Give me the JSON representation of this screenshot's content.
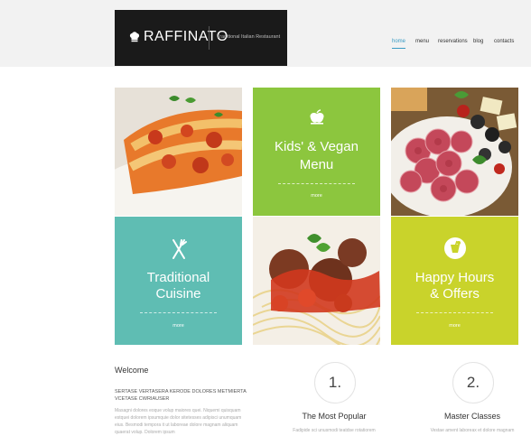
{
  "brand": {
    "name": "RAFFINATO",
    "tagline": "Traditional Italian Restaurant"
  },
  "nav": [
    {
      "label": "home",
      "active": true
    },
    {
      "label": "menu",
      "active": false
    },
    {
      "label": "reservations",
      "active": false
    },
    {
      "label": "blog",
      "active": false
    },
    {
      "label": "contacts",
      "active": false
    }
  ],
  "tiles": [
    {
      "title_line1": "Kids' & Vegan",
      "title_line2": "Menu",
      "more": "more",
      "color": "#8cc63e",
      "icon": "apple-icon"
    },
    {
      "title_line1": "Traditional",
      "title_line2": "Cuisine",
      "more": "more",
      "color": "#5fbdb3",
      "icon": "fork-knife-icon"
    },
    {
      "title_line1": "Happy Hours",
      "title_line2": "& Offers",
      "more": "more",
      "color": "#c9d32b",
      "icon": "cocktail-icon"
    }
  ],
  "welcome": {
    "title": "Welcome",
    "subtitle": "SERTASE VERTASERA KERODE DOLORES METMIERTA VCETASE CWRIAUSER",
    "body": "Masagni dolores eoque volup maiores quei. Niquemi quisquam estquei dolorem ipsumquie dolor sitetesses adipisci unumquam eius. Besmodi tempora it ut laboreae dolore magnam aliquam quaerat volup. Dolorem ipsum"
  },
  "features": [
    {
      "number": "1.",
      "title": "The Most Popular",
      "body": "Fadipide sci unusmodi teatdse rotatiorem"
    },
    {
      "number": "2.",
      "title": "Master Classes",
      "body": "Vestae ament laboreax et dolore magnam"
    }
  ]
}
